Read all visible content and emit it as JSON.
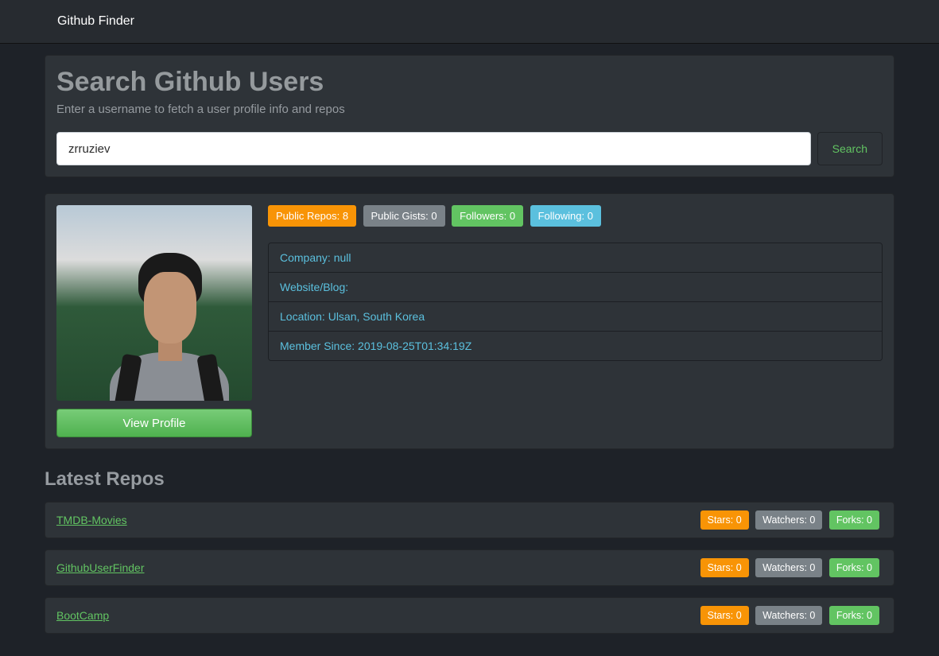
{
  "navbar": {
    "brand": "Github Finder"
  },
  "search": {
    "heading": "Search Github Users",
    "subheading": "Enter a username to fetch a user profile info and repos",
    "value": "zrruziev",
    "button_label": "Search"
  },
  "profile": {
    "badges": {
      "public_repos": "Public Repos: 8",
      "public_gists": "Public Gists: 0",
      "followers": "Followers: 0",
      "following": "Following: 0"
    },
    "info": {
      "company": "Company: null",
      "website": "Website/Blog:",
      "location": "Location: Ulsan, South Korea",
      "member_since": "Member Since: 2019-08-25T01:34:19Z"
    },
    "view_profile_label": "View Profile"
  },
  "repos": {
    "section_title": "Latest Repos",
    "badge_labels": {
      "stars": "Stars: 0",
      "watchers": "Watchers: 0",
      "forks": "Forks: 0"
    },
    "items": [
      {
        "name": "TMDB-Movies"
      },
      {
        "name": "GithubUserFinder"
      },
      {
        "name": "BootCamp"
      }
    ]
  }
}
